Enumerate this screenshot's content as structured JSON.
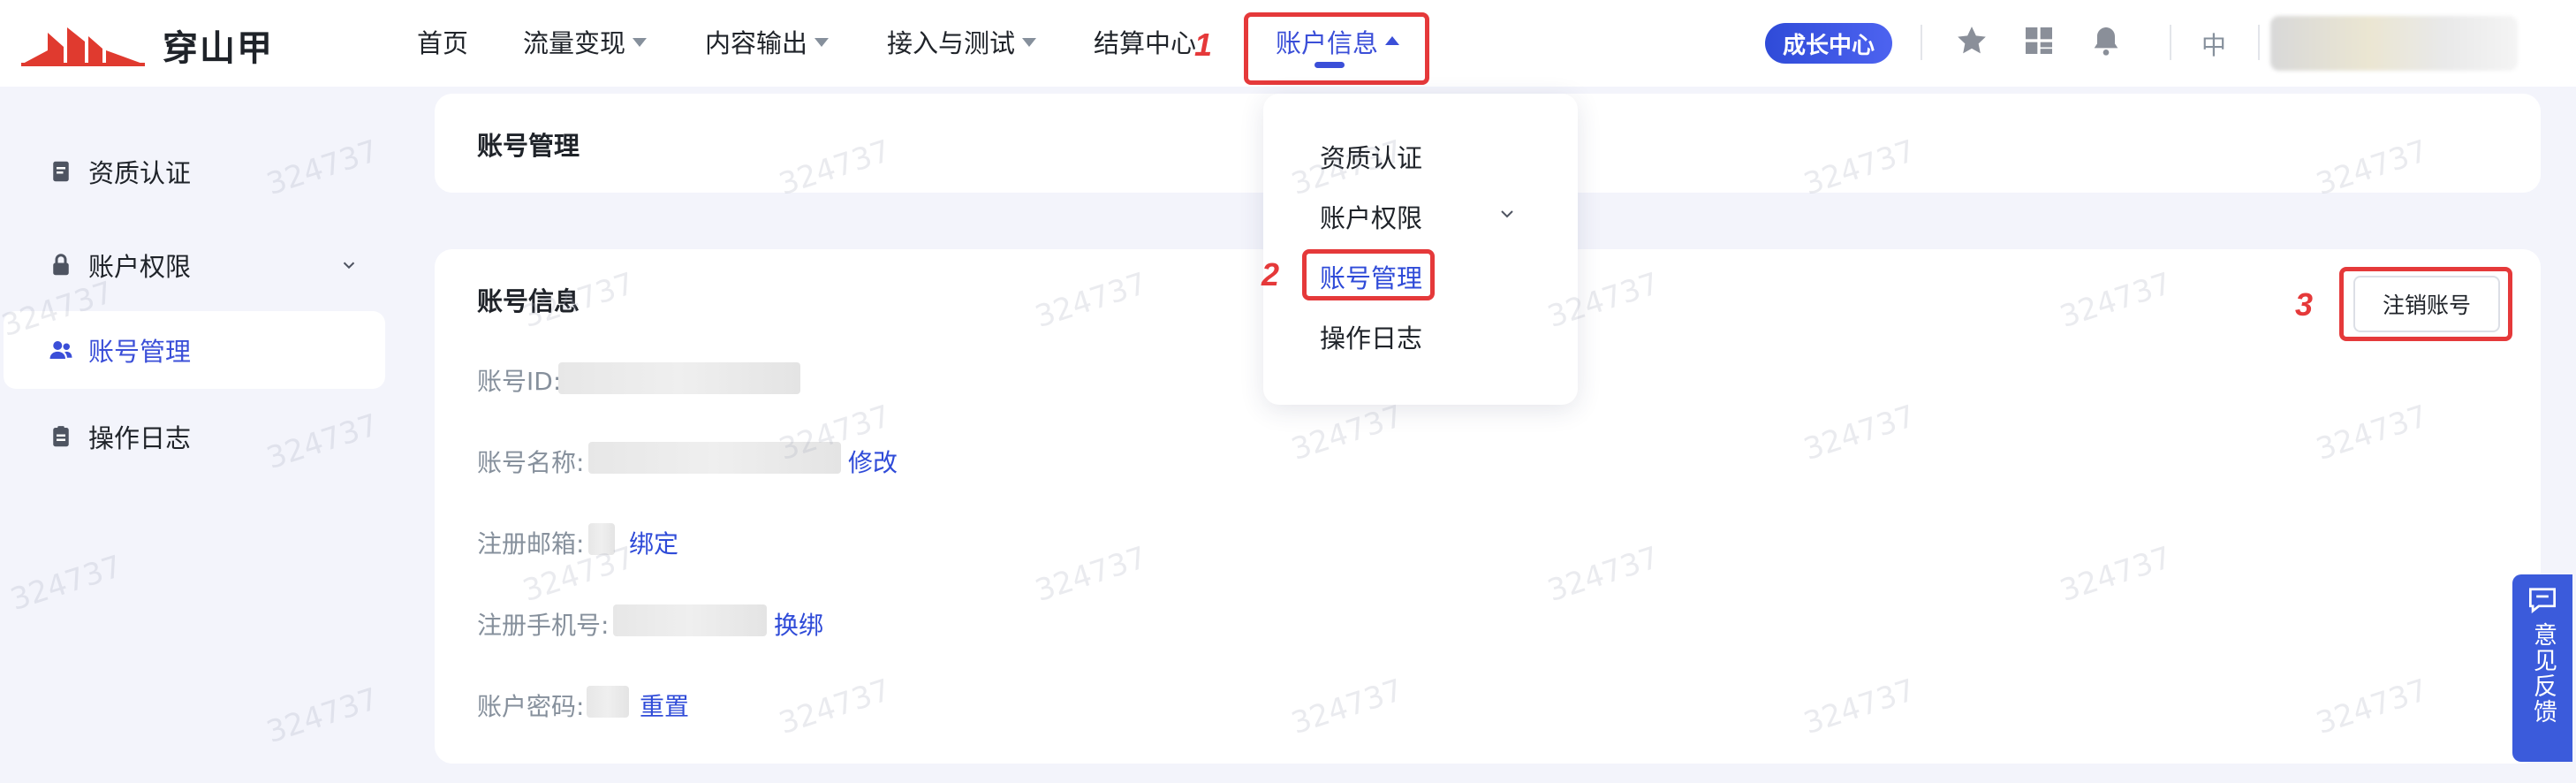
{
  "brand": {
    "name": "穿山甲",
    "accent": "#3b4fd8",
    "annotation_color": "#e5393a"
  },
  "nav": {
    "items": [
      {
        "label": "首页",
        "has_caret": false
      },
      {
        "label": "流量变现",
        "has_caret": true
      },
      {
        "label": "内容输出",
        "has_caret": true
      },
      {
        "label": "接入与测试",
        "has_caret": true
      },
      {
        "label": "结算中心",
        "has_caret": false
      },
      {
        "label": "账户信息",
        "has_caret": true,
        "active": true
      }
    ],
    "growth_badge": "成长中心",
    "lang": "中",
    "icons": [
      "star-icon",
      "grid-icon",
      "bell-icon"
    ]
  },
  "annotations": {
    "step1": "1",
    "step2": "2",
    "step3": "3"
  },
  "sidebar": {
    "items": [
      {
        "label": "资质认证",
        "icon": "document-icon"
      },
      {
        "label": "账户权限",
        "icon": "lock-icon",
        "expandable": true
      },
      {
        "label": "账号管理",
        "icon": "users-icon",
        "active": true
      },
      {
        "label": "操作日志",
        "icon": "clipboard-icon"
      }
    ]
  },
  "breadcrumb_card": {
    "title": "账号管理"
  },
  "account_info": {
    "title": "账号信息",
    "cancel_button": "注销账号",
    "fields": [
      {
        "label": "账号ID:",
        "action": ""
      },
      {
        "label": "账号名称:",
        "action": "修改"
      },
      {
        "label": "注册邮箱:",
        "action": "绑定"
      },
      {
        "label": "注册手机号:",
        "action": "换绑"
      },
      {
        "label": "账户密码:",
        "action": "重置"
      }
    ]
  },
  "dropdown": {
    "items": [
      {
        "label": "资质认证"
      },
      {
        "label": "账户权限",
        "expandable": true
      },
      {
        "label": "账号管理",
        "active": true
      },
      {
        "label": "操作日志"
      }
    ]
  },
  "feedback": {
    "label": "意见反馈"
  },
  "watermark": "324737"
}
